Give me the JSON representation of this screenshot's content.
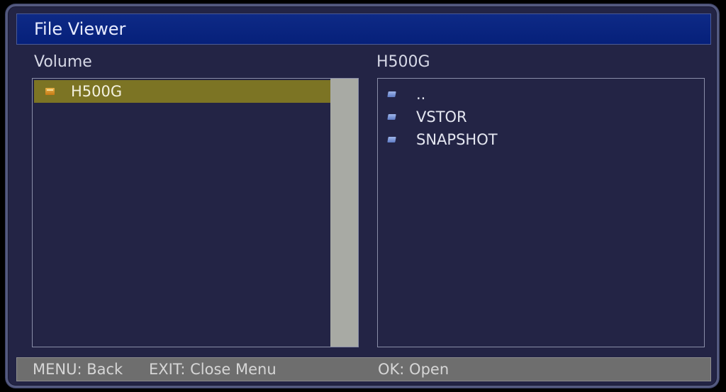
{
  "window": {
    "title": "File Viewer"
  },
  "volume_panel": {
    "label": "Volume",
    "items": [
      {
        "label": "H500G",
        "icon": "drive-icon",
        "selected": true
      }
    ]
  },
  "content_panel": {
    "label": "H500G",
    "items": [
      {
        "label": "..",
        "icon": "folder-icon"
      },
      {
        "label": "VSTOR",
        "icon": "folder-icon"
      },
      {
        "label": "SNAPSHOT",
        "icon": "folder-icon"
      }
    ]
  },
  "status_bar": {
    "back": "MENU: Back",
    "exit": "EXIT: Close Menu",
    "open": "OK: Open"
  },
  "colors": {
    "background": "#232445",
    "title_bar": "#06207a",
    "selection": "#7c7424",
    "scrollbar": "#a8aaa4",
    "status_bar": "#6e6e6e"
  }
}
